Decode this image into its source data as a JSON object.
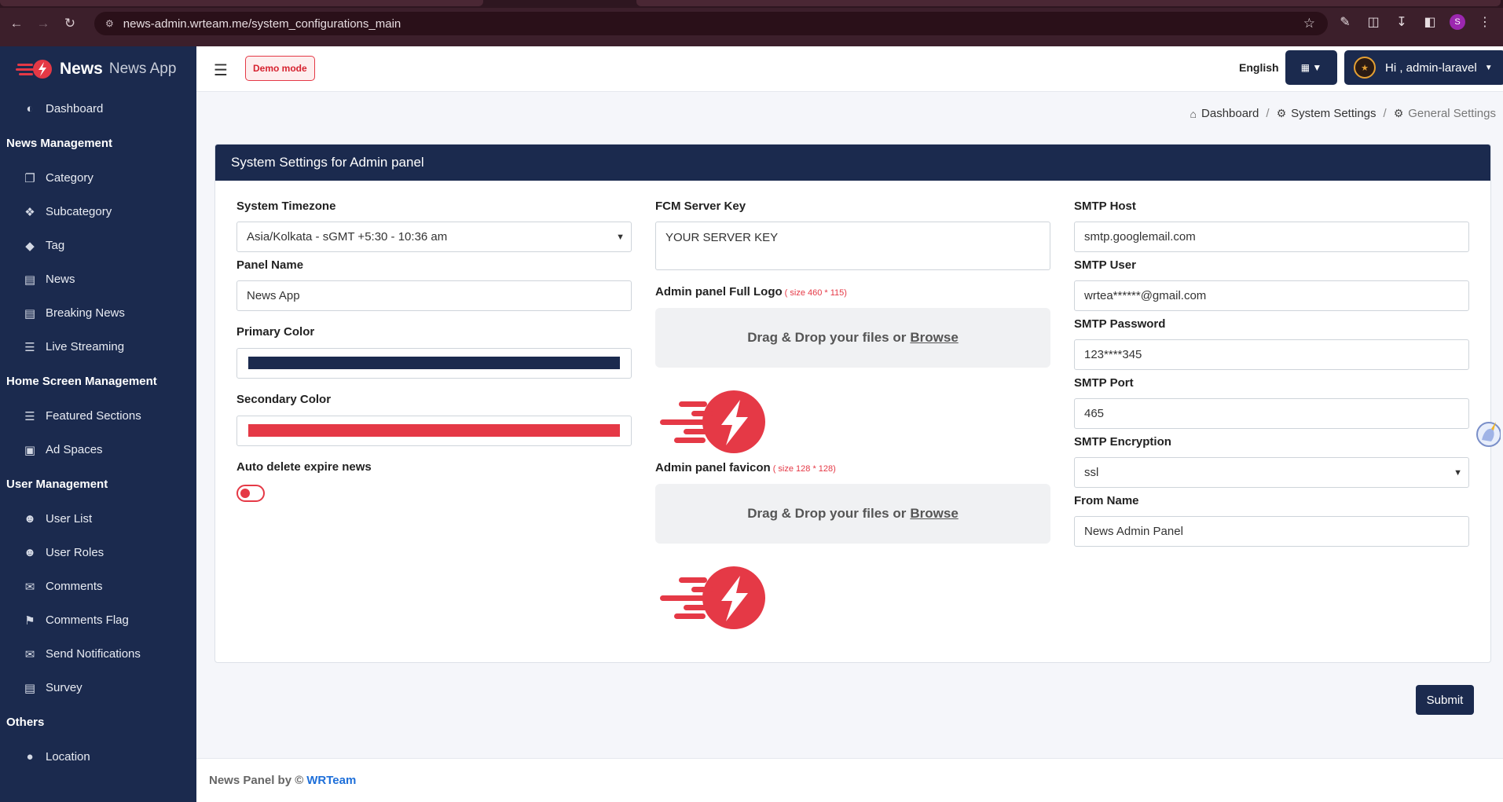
{
  "browser": {
    "url": "news-admin.wrteam.me/system_configurations_main",
    "profile_initial": "S"
  },
  "brand": {
    "name_bold": "News",
    "name_light": "News App"
  },
  "sidebar": {
    "dashboard": "Dashboard",
    "sections": [
      {
        "heading": "News Management",
        "items": [
          "Category",
          "Subcategory",
          "Tag",
          "News",
          "Breaking News",
          "Live Streaming"
        ]
      },
      {
        "heading": "Home Screen Management",
        "items": [
          "Featured Sections",
          "Ad Spaces"
        ]
      },
      {
        "heading": "User Management",
        "items": [
          "User List",
          "User Roles",
          "Comments",
          "Comments Flag",
          "Send Notifications",
          "Survey"
        ]
      },
      {
        "heading": "Others",
        "items": [
          "Location"
        ]
      }
    ]
  },
  "topbar": {
    "demo_badge": "Demo mode",
    "language": "English",
    "greeting": "Hi , admin-laravel"
  },
  "breadcrumb": {
    "home": "Dashboard",
    "parent": "System Settings",
    "current": "General Settings"
  },
  "card": {
    "title": "System Settings for Admin panel"
  },
  "form": {
    "timezone_label": "System Timezone",
    "timezone_value": "Asia/Kolkata - sGMT +5:30 - 10:36 am",
    "panel_name_label": "Panel Name",
    "panel_name_value": "News App",
    "primary_color_label": "Primary Color",
    "primary_color_value": "#1b2a4e",
    "secondary_color_label": "Secondary Color",
    "secondary_color_value": "#e53946",
    "auto_delete_label": "Auto delete expire news",
    "auto_delete_enabled": false,
    "fcm_label": "FCM Server Key",
    "fcm_value": "YOUR SERVER KEY",
    "full_logo_label": "Admin panel Full Logo",
    "full_logo_hint": "( size 460 * 115)",
    "favicon_label": "Admin panel favicon",
    "favicon_hint": "( size 128 * 128)",
    "dropzone_text": "Drag & Drop your files or",
    "dropzone_browse": "Browse",
    "smtp_host_label": "SMTP Host",
    "smtp_host_value": "smtp.googlemail.com",
    "smtp_user_label": "SMTP User",
    "smtp_user_value": "wrtea******@gmail.com",
    "smtp_password_label": "SMTP Password",
    "smtp_password_value": "123****345",
    "smtp_port_label": "SMTP Port",
    "smtp_port_value": "465",
    "smtp_encryption_label": "SMTP Encryption",
    "smtp_encryption_value": "ssl",
    "from_name_label": "From Name",
    "from_name_value": "News Admin Panel",
    "submit": "Submit"
  },
  "footer": {
    "text": "News Panel by ©",
    "link": "WRTeam"
  },
  "icons": {
    "back": "arrow-left-icon",
    "forward": "arrow-right-icon",
    "reload": "reload-icon",
    "menu": "hamburger-icon"
  },
  "colors": {
    "sidebar_bg": "#1b2a4e",
    "accent_red": "#e53946",
    "link_blue": "#1e6fd9"
  }
}
